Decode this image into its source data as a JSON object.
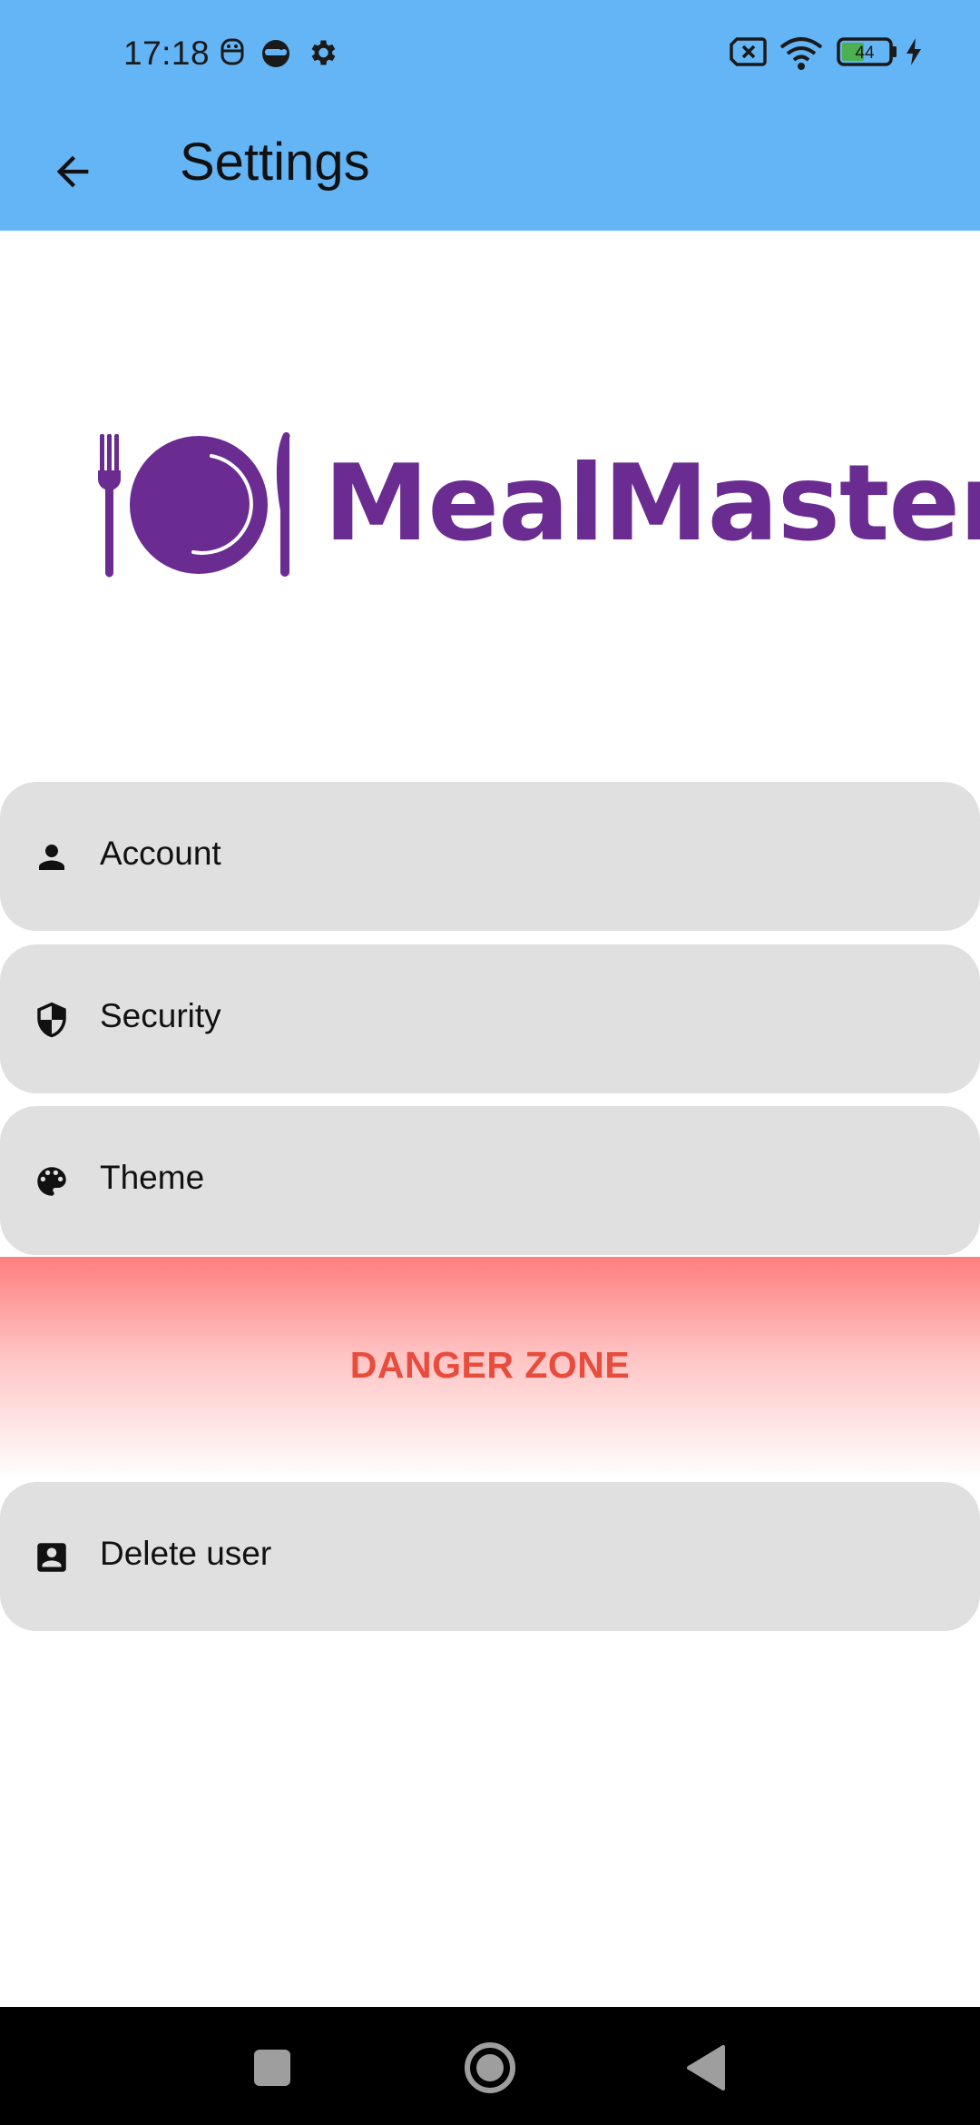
{
  "status_bar": {
    "time": "17:18",
    "battery_level": "44",
    "background": "#64B5F6",
    "icons": [
      "android-robot-icon",
      "game-controller-icon",
      "settings-gear-icon",
      "no-sim-icon",
      "wifi-icon",
      "battery-icon",
      "charging-bolt-icon"
    ]
  },
  "app_bar": {
    "title": "Settings",
    "back_icon": "arrow-back-icon",
    "background": "#64B5F6"
  },
  "logo": {
    "brand_name": "MealMaster",
    "brand_color": "#6A2C91",
    "icon": "plate-fork-knife-icon"
  },
  "settings_items": [
    {
      "label": "Account",
      "icon": "person-icon"
    },
    {
      "label": "Security",
      "icon": "shield-icon"
    },
    {
      "label": "Theme",
      "icon": "palette-icon"
    }
  ],
  "danger_zone": {
    "label": "DANGER ZONE",
    "color": "#E84C3D",
    "items": [
      {
        "label": "Delete user",
        "icon": "account-box-icon"
      }
    ]
  },
  "nav_bar": {
    "buttons": [
      "recents-square-icon",
      "home-circle-icon",
      "back-triangle-icon"
    ]
  }
}
